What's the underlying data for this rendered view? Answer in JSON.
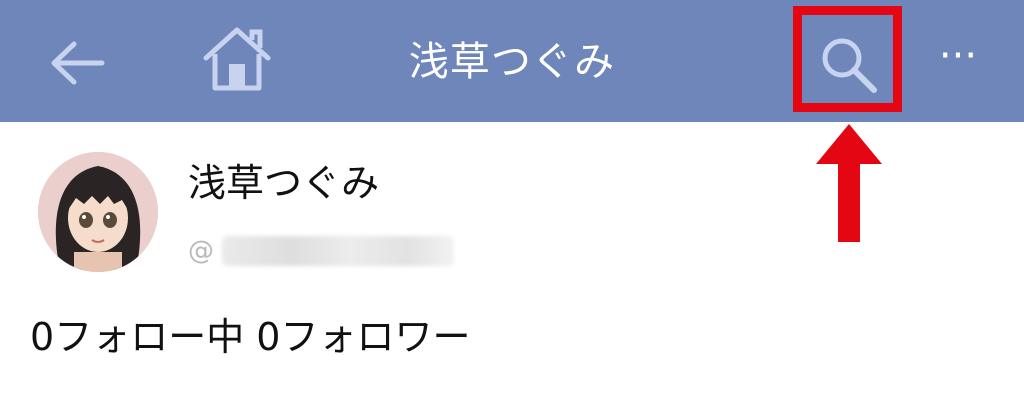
{
  "header": {
    "title": "浅草つぐみ",
    "more_label": "···"
  },
  "profile": {
    "display_name": "浅草つぐみ",
    "handle_prefix": "@",
    "following_count": "0",
    "following_label": "フォロー中",
    "followers_count": "0",
    "followers_label": "フォロワー"
  },
  "icons": {
    "back": "back-arrow-icon",
    "home": "home-icon",
    "search": "search-icon",
    "more": "more-icon",
    "annotation": "red-arrow-icon"
  },
  "colors": {
    "header_bg": "#6f86ba",
    "icon_tint": "#c8d3f0",
    "highlight": "#e40613"
  }
}
